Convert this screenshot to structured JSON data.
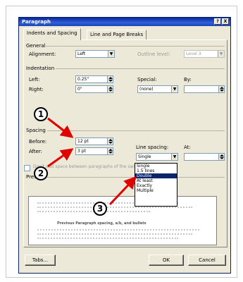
{
  "dialog": {
    "title": "Paragraph",
    "help_btn": "?",
    "close_btn": "X",
    "tabs": [
      {
        "label": "Indents and Spacing"
      },
      {
        "label": "Line and Page Breaks"
      }
    ],
    "general": {
      "heading": "General",
      "alignment_label": "Alignment:",
      "alignment_value": "Left",
      "outline_label": "Outline level:",
      "outline_value": "Level 3"
    },
    "indentation": {
      "heading": "Indentation",
      "left_label": "Left:",
      "left_value": "0.25\"",
      "right_label": "Right:",
      "right_value": "0\"",
      "special_label": "Special:",
      "special_value": "(none)",
      "by_label": "By:",
      "by_value": ""
    },
    "spacing": {
      "heading": "Spacing",
      "before_label": "Before:",
      "before_value": "12 pt",
      "after_label": "After:",
      "after_value": "3 pt",
      "line_spacing_label": "Line spacing:",
      "line_spacing_value": "Single",
      "at_label": "At:",
      "at_value": "",
      "dont_add_label": "Don't add space between paragraphs of the same style",
      "options": [
        "Single",
        "1.5 lines",
        "Double",
        "At least",
        "Exactly",
        "Multiple"
      ],
      "selected_index": 2
    },
    "preview": {
      "heading": "Preview",
      "sample_bold": "Previous Paragraph spacing, a/b, and bullets"
    },
    "buttons": {
      "tabs": "Tabs...",
      "ok": "OK",
      "cancel": "Cancel"
    }
  },
  "callouts": [
    "1",
    "2",
    "3"
  ],
  "colors": {
    "title_bar": "#0a246a",
    "dialog_bg": "#ece9d8",
    "arrow": "#e00000",
    "selection": "#0a246a"
  }
}
